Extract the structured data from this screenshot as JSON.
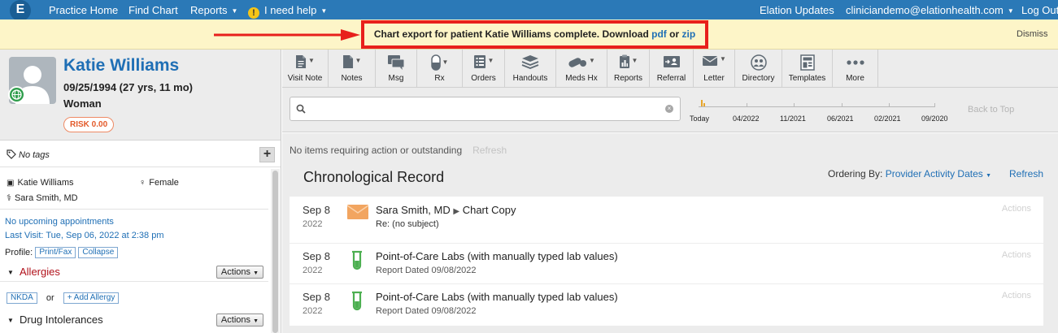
{
  "nav": {
    "logo": "E",
    "practice_home": "Practice Home",
    "find_chart": "Find Chart",
    "reports": "Reports",
    "help_icon": "!",
    "i_need_help": "I need help",
    "elation_updates": "Elation Updates",
    "user_email": "cliniciandemo@elationhealth.com",
    "logout": "Log Out"
  },
  "notice": {
    "text": "Chart export for patient Katie Williams complete. Download",
    "pdf": "pdf",
    "or": "or",
    "zip": "zip",
    "dismiss": "Dismiss",
    "highlight_color": "#e8201b"
  },
  "patient": {
    "name": "Katie Williams",
    "dob": "09/25/1994 (27 yrs, 11 mo)",
    "sex": "Woman",
    "risk": "RISK 0.00",
    "no_tags": "No tags",
    "add_tag": "+",
    "info_name": "Katie Williams",
    "gender": "Female",
    "provider": "Sara Smith, MD",
    "no_appointments": "No upcoming appointments",
    "last_visit": "Last Visit: Tue, Sep 06, 2022 at 2:38 pm",
    "profile_label": "Profile:",
    "print_fax": "Print/Fax",
    "collapse": "Collapse"
  },
  "allergies": {
    "title": "Allergies",
    "actions": "Actions",
    "nkda": "NKDA",
    "or": "or",
    "add_allergy": "+ Add Allergy"
  },
  "drug_intolerances": {
    "title": "Drug Intolerances",
    "actions": "Actions"
  },
  "toolbar": [
    {
      "label": "Visit Note",
      "icon": "document-icon"
    },
    {
      "label": "Notes",
      "icon": "document-icon"
    },
    {
      "label": "Msg",
      "icon": "chat-icon"
    },
    {
      "label": "Rx",
      "icon": "pill-icon"
    },
    {
      "label": "Orders",
      "icon": "list-icon"
    },
    {
      "label": "Handouts",
      "icon": "stack-icon"
    },
    {
      "label": "Meds Hx",
      "icon": "pills-icon"
    },
    {
      "label": "Reports",
      "icon": "chart-doc-icon"
    },
    {
      "label": "Referral",
      "icon": "referral-icon"
    },
    {
      "label": "Letter",
      "icon": "envelope-icon"
    },
    {
      "label": "Directory",
      "icon": "people-icon"
    },
    {
      "label": "Templates",
      "icon": "template-icon"
    },
    {
      "label": "More",
      "icon": "more-icon"
    }
  ],
  "search": {
    "placeholder": "",
    "clear": "×"
  },
  "timeline": {
    "labels": [
      "Today",
      "04/2022",
      "11/2021",
      "06/2021",
      "02/2021",
      "09/2020"
    ],
    "marker_color": "#e7a52b",
    "back_to_top": "Back to Top"
  },
  "main": {
    "no_items": "No items requiring action or outstanding",
    "refresh": "Refresh",
    "chrono_title": "Chronological Record",
    "ordering_label": "Ordering By:",
    "ordering_value": "Provider Activity Dates",
    "refresh_link": "Refresh"
  },
  "records": [
    {
      "month_day": "Sep 8",
      "year": "2022",
      "icon": "envelope-icon",
      "from": "Sara Smith, MD",
      "arrow": "▶",
      "title": "Chart Copy",
      "subtitle": "Re: (no subject)",
      "actions": "Actions"
    },
    {
      "month_day": "Sep 8",
      "year": "2022",
      "icon": "test-tube-icon",
      "title": "Point-of-Care Labs (with manually typed lab values)",
      "subtitle": "Report Dated 09/08/2022",
      "actions": "Actions"
    },
    {
      "month_day": "Sep 8",
      "year": "2022",
      "icon": "test-tube-icon",
      "title": "Point-of-Care Labs (with manually typed lab values)",
      "subtitle": "Report Dated 09/08/2022",
      "actions": "Actions"
    }
  ]
}
